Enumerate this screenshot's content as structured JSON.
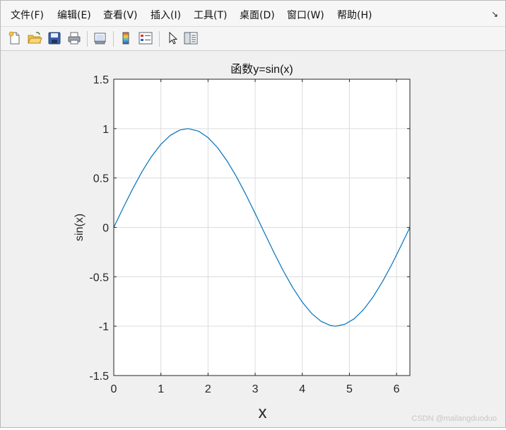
{
  "menu": {
    "items": [
      "文件(F)",
      "编辑(E)",
      "查看(V)",
      "插入(I)",
      "工具(T)",
      "桌面(D)",
      "窗口(W)",
      "帮助(H)"
    ],
    "more_icon": "↘"
  },
  "toolbar": {
    "buttons": [
      "new-figure-icon",
      "open-file-icon",
      "save-icon",
      "print-icon",
      "link-plot-icon",
      "colorbar-icon",
      "legend-icon",
      "pointer-icon",
      "property-inspector-icon"
    ]
  },
  "watermark": "CSDN @mailangduoduo",
  "chart_data": {
    "type": "line",
    "title": "函数y=sin(x)",
    "xlabel": "x",
    "ylabel": "sin(x)",
    "xlim": [
      0,
      6.2832
    ],
    "ylim": [
      -1.5,
      1.5
    ],
    "xticks": [
      "0",
      "1",
      "2",
      "3",
      "4",
      "5",
      "6"
    ],
    "yticks": [
      "1.5",
      "1",
      "0.5",
      "0",
      "-0.5",
      "-1",
      "-1.5"
    ],
    "grid": true,
    "series": [
      {
        "color": "#0072bd",
        "x": [
          0,
          0.2,
          0.4,
          0.6,
          0.8,
          1.0,
          1.2,
          1.4,
          1.5708,
          1.8,
          2.0,
          2.2,
          2.4,
          2.6,
          2.8,
          3.0,
          3.1416,
          3.4,
          3.6,
          3.8,
          4.0,
          4.2,
          4.4,
          4.6,
          4.7124,
          4.9,
          5.1,
          5.3,
          5.5,
          5.7,
          5.9,
          6.1,
          6.2832
        ],
        "y": [
          0,
          0.199,
          0.389,
          0.565,
          0.717,
          0.841,
          0.932,
          0.985,
          1.0,
          0.974,
          0.909,
          0.808,
          0.675,
          0.516,
          0.335,
          0.141,
          0.0,
          -0.256,
          -0.443,
          -0.612,
          -0.757,
          -0.872,
          -0.952,
          -0.994,
          -1.0,
          -0.982,
          -0.926,
          -0.832,
          -0.706,
          -0.551,
          -0.374,
          -0.182,
          0.0
        ]
      }
    ]
  }
}
